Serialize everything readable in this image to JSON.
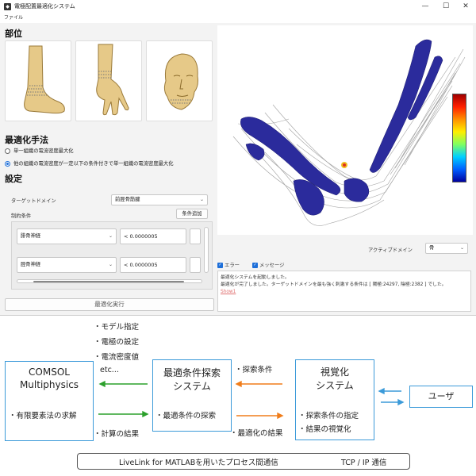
{
  "window": {
    "title": "電極配置最適化システム",
    "menu_file": "ファイル",
    "minimize": "—",
    "maximize": "☐",
    "close": "✕"
  },
  "left": {
    "section_parts": "部位",
    "section_method": "最適化手法",
    "method_option_1": "単一組織の電流密度最大化",
    "method_option_2": "他の組織の電流密度が一定以下の条件付きで単一組織の電流密度最大化",
    "selected_method": 2,
    "section_settings": "設定",
    "target_domain_label": "ターゲットドメイン",
    "target_domain_value": "前脛骨筋腱",
    "constraint_label": "制約条件",
    "add_condition_button": "条件追加",
    "constraints": [
      {
        "domain": "腓骨神経",
        "value": "< 0.0000005"
      },
      {
        "domain": "脛骨神経",
        "value": "< 0.0000005"
      }
    ],
    "run_button": "最適化実行"
  },
  "right": {
    "active_domain_label": "アクティブドメイン",
    "active_domain_value": "骨",
    "error_checkbox_label": "エラー",
    "message_checkbox_label": "メッセージ",
    "log_lines": [
      "最適化システムを起動しました。",
      "最適化が完了しました。ターゲットドメインを最も強く刺激する条件は [ 陽極:24297, 陰極:2382 ] でした。"
    ],
    "log_link": "Show1"
  },
  "diagram": {
    "comsol_title_1": "COMSOL",
    "comsol_title_2": "Multiphysics",
    "comsol_body": "・有限要素法の求解",
    "search_title_1": "最適条件探索",
    "search_title_2": "システム",
    "search_body": "・最適条件の探索",
    "vis_title_1": "視覚化",
    "vis_title_2": "システム",
    "vis_body_1": "・探索条件の指定",
    "vis_body_2": "・結果の視覚化",
    "user_title": "ユーザ",
    "to_comsol_1": "・モデル指定",
    "to_comsol_2": "・電極の設定",
    "to_comsol_3": "・電流密度値",
    "to_comsol_4": "etc...",
    "from_comsol": "・計算の結果",
    "to_search": "・探索条件",
    "from_search": "・最適化の結果",
    "legend_green": "LiveLink for MATLABを用いたプロセス間通信",
    "legend_orange": "TCP / IP 通信",
    "colors": {
      "green": "#2ca02c",
      "orange": "#f07d1a",
      "blue": "#3b9ad9"
    }
  }
}
